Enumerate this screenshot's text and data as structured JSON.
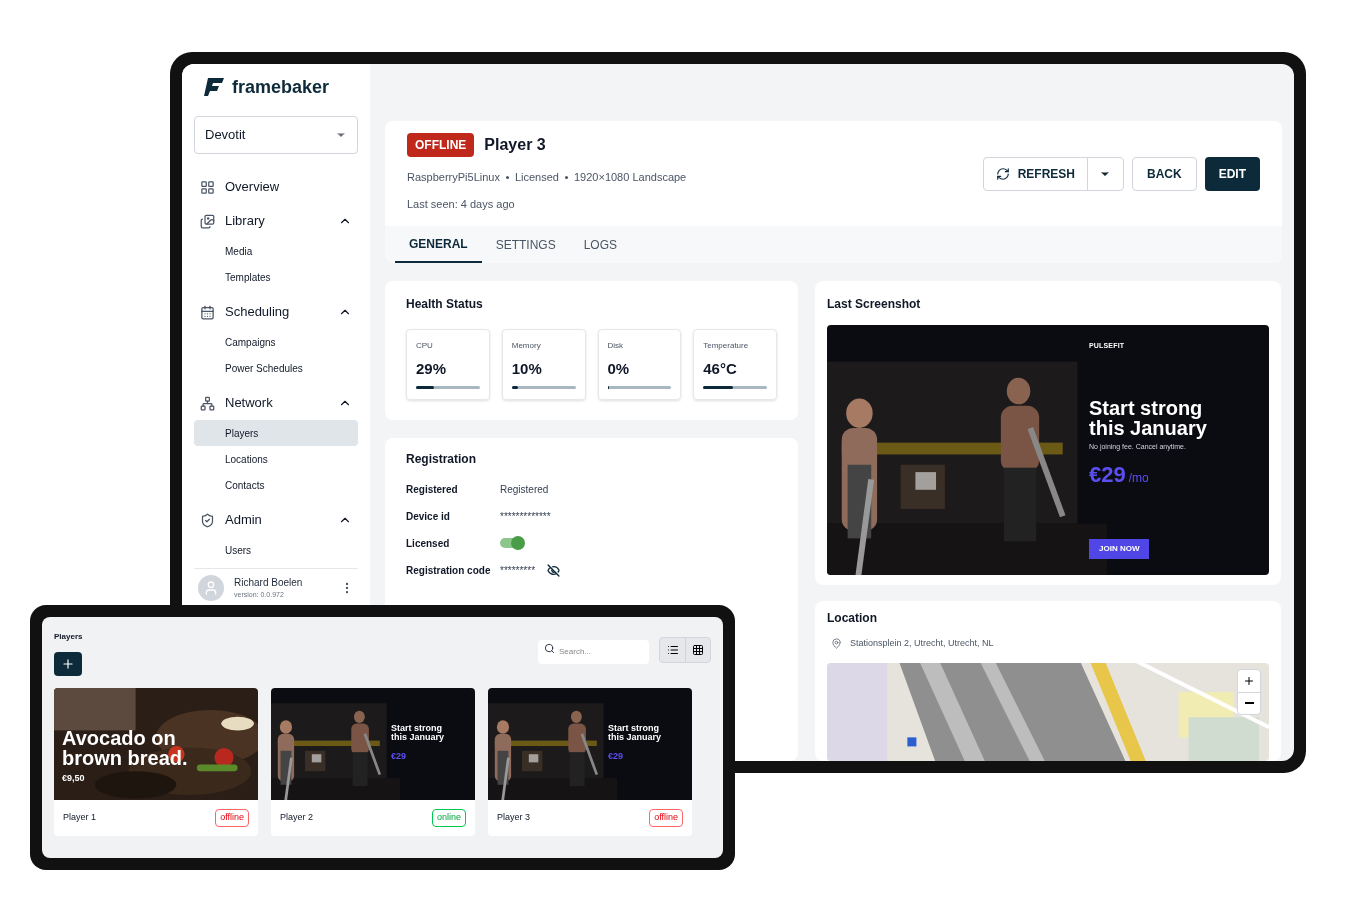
{
  "sidebar": {
    "logo": "framebaker",
    "workspace": "Devotit",
    "nav": [
      {
        "kind": "link",
        "label": "Overview"
      },
      {
        "kind": "group",
        "label": "Library",
        "expanded": true,
        "children": [
          {
            "label": "Media",
            "selected": false
          },
          {
            "label": "Templates",
            "selected": false
          }
        ]
      },
      {
        "kind": "group",
        "label": "Scheduling",
        "expanded": true,
        "children": [
          {
            "label": "Campaigns",
            "selected": false
          },
          {
            "label": "Power Schedules",
            "selected": false
          }
        ]
      },
      {
        "kind": "group",
        "label": "Network",
        "expanded": true,
        "children": [
          {
            "label": "Players",
            "selected": true
          },
          {
            "label": "Locations",
            "selected": false
          },
          {
            "label": "Contacts",
            "selected": false
          }
        ]
      },
      {
        "kind": "group",
        "label": "Admin",
        "expanded": true,
        "children": [
          {
            "label": "Users",
            "selected": false
          }
        ]
      }
    ],
    "user": {
      "name": "Richard Boelen",
      "version": "version: 0.0.972"
    }
  },
  "player": {
    "status": "OFFLINE",
    "online": false,
    "name": "Player 3",
    "meta": [
      "RaspberryPi5Linux",
      "Licensed",
      "1920×1080 Landscape"
    ],
    "last_seen": "Last seen: 4 days ago",
    "buttons": [
      "REFRESH",
      "BACK",
      "EDIT"
    ]
  },
  "tabs": [
    {
      "label": "GENERAL",
      "selected": true
    },
    {
      "label": "SETTINGS",
      "selected": false
    },
    {
      "label": "LOGS",
      "selected": false
    }
  ],
  "health": {
    "title": "Health Status",
    "metrics": [
      {
        "label": "CPU",
        "value": "29%",
        "level": 0.29
      },
      {
        "label": "Memory",
        "value": "10%",
        "level": 0.1
      },
      {
        "label": "Disk",
        "value": "0%",
        "level": 0
      },
      {
        "label": "Temperature",
        "value": "46°C",
        "level": 0.46
      }
    ]
  },
  "registration": {
    "title": "Registration",
    "rows": [
      {
        "kind": "text",
        "label": "Registered",
        "value": "Registered"
      },
      {
        "kind": "text",
        "label": "Device id",
        "value": "*************"
      },
      {
        "kind": "toggle",
        "label": "Licensed",
        "on": true
      },
      {
        "kind": "secret",
        "label": "Registration code",
        "value": "*********"
      }
    ]
  },
  "screenshot": {
    "title": "Last Screenshot",
    "slide": {
      "brand": "PULSEFIT",
      "headline": "Start strong this January",
      "sub": "No joining fee. Cancel anytime.",
      "price": "€29",
      "unit": "/mo",
      "cta": "JOIN NOW"
    }
  },
  "location": {
    "title": "Location",
    "address": "Stationsplein 2, Utrecht, Utrecht, NL"
  },
  "tablet": {
    "title": "Players",
    "search_placeholder": "Search...",
    "players": [
      {
        "name": "Player 1",
        "status": "offline",
        "online": false,
        "slide": {
          "kind": "food",
          "headline": "Avocado on brown bread.",
          "price": "€9,50"
        }
      },
      {
        "name": "Player 2",
        "status": "online",
        "online": true,
        "slide": {
          "kind": "fitness",
          "headline": "Start strong this January",
          "price": "€29"
        }
      },
      {
        "name": "Player 3",
        "status": "offline",
        "online": false,
        "slide": {
          "kind": "fitness",
          "headline": "Start strong this January",
          "price": "€29"
        }
      }
    ]
  }
}
